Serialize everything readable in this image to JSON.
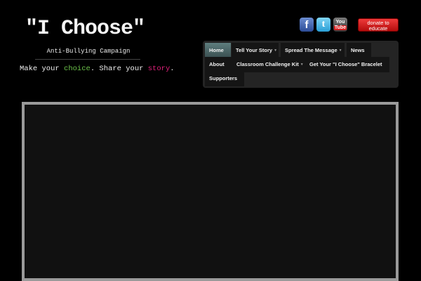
{
  "header": {
    "title": "\"I Choose\"",
    "subtitle": "Anti-Bullying Campaign",
    "tagline": {
      "part1": "Make your ",
      "choice": "choice",
      "part2": ". Share your ",
      "story": "story",
      "part3": "."
    }
  },
  "social": {
    "facebook": "f",
    "twitter": "t",
    "youtube_you": "You",
    "youtube_tube": "Tube"
  },
  "donate": {
    "line1": "donate to",
    "line2": "educate"
  },
  "nav": {
    "items": [
      {
        "label": "Home",
        "dropdown": false
      },
      {
        "label": "Tell Your Story",
        "dropdown": true
      },
      {
        "label": "Spread The Message",
        "dropdown": true
      },
      {
        "label": "News",
        "dropdown": false
      },
      {
        "label": "About",
        "dropdown": false
      },
      {
        "label": "Classroom Challenge Kit",
        "dropdown": true
      },
      {
        "label": "Get Your \"I Choose\" Bracelet",
        "dropdown": false
      },
      {
        "label": "Supporters",
        "dropdown": false
      }
    ]
  },
  "colors": {
    "background": "#000000",
    "choice": "#6cc24a",
    "story": "#e0207a",
    "donate": "#d41f1f",
    "nav_active": "#4b6667"
  }
}
